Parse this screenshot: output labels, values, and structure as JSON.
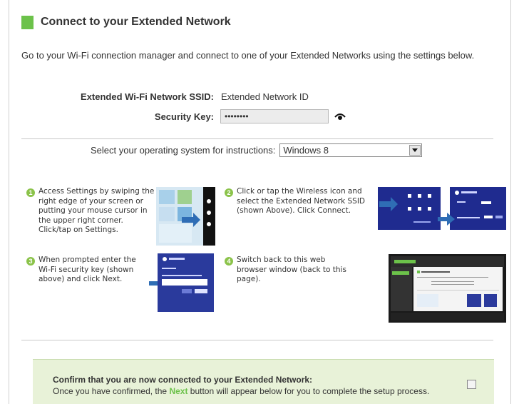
{
  "header": {
    "title": "Connect to your Extended Network"
  },
  "intro": "Go to your Wi-Fi connection manager and connect to one of your Extended Networks using the settings below.",
  "network": {
    "ssid_label": "Extended Wi-Fi Network SSID:",
    "ssid_value": "Extended Network ID",
    "key_label": "Security Key:",
    "key_value": "••••••••"
  },
  "os_select": {
    "label": "Select your operating system for instructions:",
    "selected": "Windows 8"
  },
  "steps": [
    {
      "num": "1",
      "text": "Access Settings by swiping the right edge of your screen or putting your mouse cursor in the upper right corner. Click/tap on Settings."
    },
    {
      "num": "2",
      "text": "Click or tap the Wireless icon and select the Extended Network SSID (shown Above). Click Connect."
    },
    {
      "num": "3",
      "text": "When prompted enter the Wi-Fi security key (shown above) and click Next."
    },
    {
      "num": "4",
      "text": "Switch back to this web browser window (back to this page)."
    }
  ],
  "confirm": {
    "title": "Confirm that you are now connected to your Extended Network:",
    "text_before": "Once you have confirmed, the ",
    "next_word": "Next",
    "text_after": " button will appear below for you to complete the setup process."
  },
  "colors": {
    "accent": "#6cc24a",
    "step_badge": "#8bc34a",
    "confirm_bg": "#e8f2d8"
  }
}
